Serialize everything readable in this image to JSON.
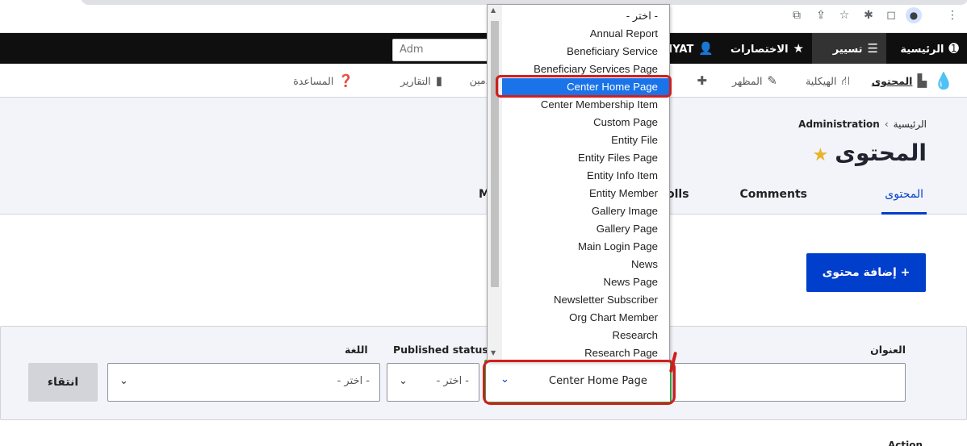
{
  "toolbar": {
    "home": "الرئيسية",
    "manage": "تسيير",
    "shortcuts": "الاختصارات",
    "user": "NIYAT",
    "search_value": "Adm"
  },
  "tray": {
    "content": "المحتوى",
    "structure": "الهيكلية",
    "appearance": "المظهر",
    "people": "مستخدمين",
    "reports": "التقارير",
    "help": "المساعدة"
  },
  "breadcrumb": {
    "home": "الرئيسية",
    "separator": "›",
    "admin": "Administration"
  },
  "page": {
    "title": "المحتوى",
    "tabs": {
      "content": "المحتوى",
      "comments": "Comments",
      "polls": "olls",
      "media": "M"
    },
    "add_button": "+ إضافة محتوى"
  },
  "filters": {
    "title_label": "العنوان",
    "published_label": "Published status",
    "language_label": "اللغة",
    "published_value": "- اختر -",
    "language_value": "- اختر -",
    "type_value": "Center Home Page",
    "apply_button": "انتقاء"
  },
  "action_label": "Action",
  "dropdown": {
    "items": [
      "- اختر -",
      "Annual Report",
      "Beneficiary Service",
      "Beneficiary Services Page",
      "Center Home Page",
      "Center Membership Item",
      "Custom Page",
      "Entity File",
      "Entity Files Page",
      "Entity Info Item",
      "Entity Member",
      "Gallery Image",
      "Gallery Page",
      "Main Login Page",
      "News",
      "News Page",
      "Newsletter Subscriber",
      "Org Chart Member",
      "Research",
      "Research Page"
    ],
    "selected_index": 4
  },
  "colors": {
    "accent": "#003ecc",
    "selection": "#1a73e8",
    "annotation": "#d01e1e",
    "toolbar": "#0f0f0f"
  }
}
